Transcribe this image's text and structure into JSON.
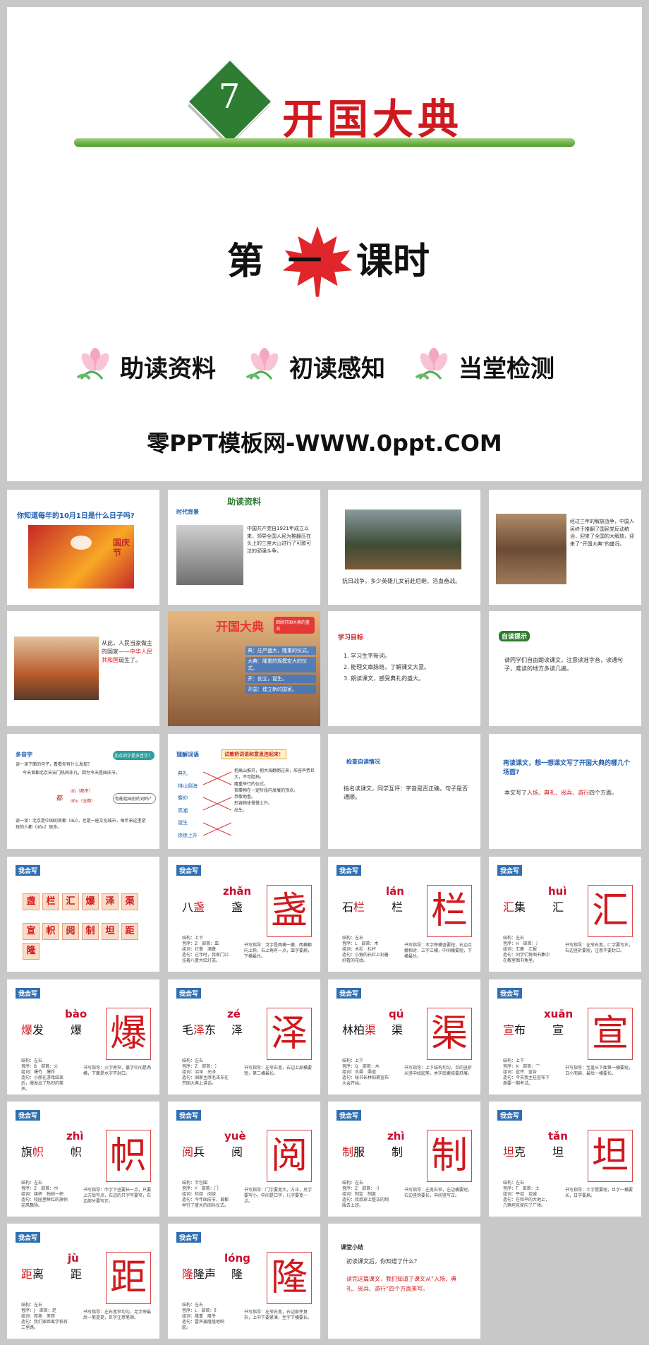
{
  "cover": {
    "lesson_number": "7",
    "title": "开国大典",
    "lesson_prefix": "第",
    "lesson_num_word": "一",
    "lesson_suffix": "课时",
    "sections": [
      "助读资料",
      "初读感知",
      "当堂检测"
    ],
    "footer": "零PPT模板网-WWW.0ppt.COM"
  },
  "slides": {
    "s1": {
      "question": "你知道每年的10月1日是什么日子吗?",
      "festival": "国庆节"
    },
    "s2": {
      "header": "助读资料",
      "tag": "时代背景",
      "text": "中国共产党自1921年成立以来，领导全国人民为推翻压在头上的三座大山进行了可歌可泣的顽强斗争。"
    },
    "s3": {
      "caption": "抗日战争，多少英雄儿女前赴后继、浴血奋战。"
    },
    "s4": {
      "text": "经过三年的解放战争，中国人民终于推翻了国民党反动统治，迎来了全国的大解放，迎来了“开国大典”的盛况。"
    },
    "s5": {
      "text1": "从此，人民当家做主的国家——",
      "highlight": "中华人民共和国",
      "text2": "诞生了。"
    },
    "s6": {
      "title": "开国大典",
      "bubble": "回顾开国大典的盛况",
      "items": [
        "典：庄严盛大，隆重的仪式。",
        "大典：隆重的规模宏大的仪式。",
        "开：创立，诞生。",
        "开国：建立新的国家。"
      ]
    },
    "s7": {
      "tag": "学习目标",
      "goals": [
        "1. 学习生字新词。",
        "2. 能理文章脉络，了解课文大意。",
        "3. 朗读课文，感受典礼的盛大。"
      ]
    },
    "s8": {
      "tag": "自读提示",
      "text": "请同学们自由朗读课文，注意读准字音，读通句子，难读的地方多读几遍。"
    },
    "s9": {
      "tag": "多音字",
      "intro": "读一读下面的句子，看看你有什么发现？",
      "sentence": "今天首都北京天安门热闹非凡，因为今天是国庆节。",
      "bubble1": "加点的字是多音字！",
      "bubble2": "你能组出别的词吗？",
      "reading1": "dū（都市）",
      "reading2": "dōu（全都）",
      "char": "都",
      "practice": "读一读：北京是中国的首都（dū），也是一座文化城市，每年来这里游玩的人都（dōu）很多。"
    },
    "s10": {
      "tag": "理解词语",
      "header": "试着把词语和意思连起来！",
      "words": [
        "典礼",
        "排山倒海",
        "瞻仰",
        "高潮",
        "诞生",
        "徐徐上升"
      ],
      "meanings": [
        "把高山推开，把大海翻倒过来，形容声势巨大，不可阻挡。",
        "隆重举行的仪式。",
        "指事物在一定阶段内发展的顶点。",
        "恭敬地看。",
        "形容物体慢慢上升。",
        "出生。"
      ]
    },
    "s11": {
      "tag": "检查自读情况",
      "text": "指名读课文，同学互评：字音是否正确，句子是否通顺。"
    },
    "s12": {
      "question": "再读课文，想一想课文写了开国大典的哪几个场面?",
      "answer_prefix": "本文写了",
      "scenes": "入场、典礼、阅兵、游行",
      "answer_suffix": "四个方面。"
    },
    "s13": {
      "tag": "我会写",
      "chars": [
        "盏",
        "栏",
        "汇",
        "爆",
        "泽",
        "渠",
        "宣",
        "帜",
        "阅",
        "制",
        "坦",
        "距",
        "隆"
      ]
    },
    "s14": {
      "tag": "我会写",
      "word_red": "盏",
      "word_pre": "八",
      "word_post": "",
      "char": "盏",
      "pinyin": "zhǎn",
      "s1": "结构：上下",
      "s2": "音序：Z　部首：皿",
      "s3": "组词：灯盏　酒盏",
      "s4": "造句：过年时，我家门口挂着八盏大红灯笼。",
      "tip": "书写指导：戈字是两横一撇，两横都向上斜，右上角有一点，皿字要扁，下横最长。"
    },
    "s15": {
      "tag": "我会写",
      "word_red": "栏",
      "word_pre": "石",
      "word_post": "",
      "char": "栏",
      "pinyin": "lán",
      "s1": "结构：左右",
      "s2": "音序：L　部首：木",
      "s3": "组词：木栏　栏杆",
      "s4": "造句：小猴的石栏上刻着好看的花纹。",
      "tip": "书写指导：木字旁横竖要短，右边点撇相对，三字三横，中间横要短，下横最长。"
    },
    "s16": {
      "tag": "我会写",
      "word_red": "汇",
      "word_pre": "",
      "word_post": "集",
      "char": "汇",
      "pinyin": "huì",
      "s1": "结构：左右",
      "s2": "音序：H　部首：氵",
      "s3": "组词：汇集　汇报",
      "s4": "造句：同学们将图书集中在教室图书角里。",
      "tip": "书写指导：左窄右宽，匚字要写正，右边竖折要短，注意不要封口。"
    },
    "s17": {
      "tag": "我会写",
      "word_red": "爆",
      "word_pre": "",
      "word_post": "发",
      "char": "爆",
      "pinyin": "bào",
      "s1": "结构：左右",
      "s2": "音序：B　部首：火",
      "s3": "组词：爆竹　爆炸",
      "s4": "造句：小丽在游戏结束后，爆发出了热烈的笑声。",
      "tip": "书写指导：火字旁窄，暴字中间是两横，下面是水字不封口。"
    },
    "s18": {
      "tag": "我会写",
      "word_red": "泽",
      "word_pre": "毛",
      "word_post": "东",
      "char": "泽",
      "pinyin": "zé",
      "s1": "结构：左右",
      "s2": "音序：Z　部首：氵",
      "s3": "组词：沼泽　光泽",
      "s4": "造句：国家主席毛泽东在开国大典上讲话。",
      "tip": "书写指导：左窄右宽，右边上部横要短，第二横最长。"
    },
    "s19": {
      "tag": "我会写",
      "word_red": "渠",
      "word_pre": "林柏",
      "word_post": "",
      "char": "渠",
      "pinyin": "qú",
      "s1": "结构：上下",
      "s2": "音序：Q　部首：木",
      "s3": "组词：水渠　渠道",
      "s4": "造句：秘书长林柏渠宣布大会开始。",
      "tip": "书写指导：上下结构均匀，巨的竖折从竖中线起笔，木字底撇捺要舒展。"
    },
    "s20": {
      "tag": "我会写",
      "word_red": "宣",
      "word_pre": "",
      "word_post": "布",
      "char": "宣",
      "pinyin": "xuān",
      "s1": "结构：上下",
      "s2": "音序：X　部首：宀",
      "s3": "组词：宣传　宣告",
      "s4": "造句：今天我主任宣布下周要一期考试。",
      "tip": "书写指导：宝盖头下面第一横要短，日小而扁，最后一横要长。"
    },
    "s21": {
      "tag": "我会写",
      "word_red": "帜",
      "word_pre": "旗",
      "word_post": "",
      "char": "帜",
      "pinyin": "zhì",
      "s1": "结构：左右",
      "s2": "音序：Z　部首：巾",
      "s3": "组词：旗帜　独树一帜",
      "s4": "造句：校园里鲜红的旗帜迎风飘扬。",
      "tip": "书写指导：巾字下竖要长一点，只要上方后写点，右边的只字写要窄，右边部分要写正。"
    },
    "s22": {
      "tag": "我会写",
      "word_red": "阅",
      "word_pre": "",
      "word_post": "兵",
      "char": "阅",
      "pinyin": "yuè",
      "s1": "结构：半包围",
      "s2": "音序：Y　部首：门",
      "s3": "组词：检阅　阅读",
      "s4": "造句：今年国庆节，首都举行了盛大的阅兵仪式。",
      "tip": "书写指导：门字要宽大，方正，兑字要写小，中间是口字，儿字要宽一点。"
    },
    "s23": {
      "tag": "我会写",
      "word_red": "制",
      "word_pre": "",
      "word_post": "服",
      "char": "制",
      "pinyin": "zhì",
      "s1": "结构：左右",
      "s2": "音序：Z　部首：刂",
      "s3": "组词：制定　制度",
      "s4": "造句：叔叔穿上整洁的制服去上班。",
      "tip": "书写指导：左宽右窄，左边横要短，右边竖钩要长，中间竖写正。"
    },
    "s24": {
      "tag": "我会写",
      "word_red": "坦",
      "word_pre": "",
      "word_post": "克",
      "char": "坦",
      "pinyin": "tǎn",
      "s1": "结构：左右",
      "s2": "音序：T　部首：土",
      "s3": "组词：平坦　坦诚",
      "s4": "造句：在和平的大地上，几辆坦克驶向了广场。",
      "tip": "书写指导：土字提要短，旦字一横要长，日字要扁。"
    },
    "s25": {
      "tag": "我会写",
      "word_red": "距",
      "word_pre": "",
      "word_post": "离",
      "char": "距",
      "pinyin": "jù",
      "s1": "结构：左右",
      "s2": "音序：J　部首：足",
      "s3": "组词：距离　差距",
      "s4": "造句：我们家距离学校有三里路。",
      "tip": "书写指导：左右宽窄均匀，足字旁最后一笔是提，巨字注意笔顺。"
    },
    "s26": {
      "tag": "我会写",
      "word_red": "隆",
      "word_pre": "",
      "word_post": "隆声",
      "char": "隆",
      "pinyin": "lóng",
      "s1": "结构：左右",
      "s2": "音序：L　部首：阝",
      "s3": "组词：隆重　隆冬",
      "s4": "造句：雷声轰隆隆地响起。",
      "tip": "书写指导：左窄右宽，右边部件复杂，上中下要紧凑，生字下横要长。"
    },
    "s27": {
      "tag": "课堂小结",
      "question": "初读课文后，你知道了什么？",
      "answer_a": "读完这篇课文，我们知道了课文从",
      "answer_b": "“入场、典礼、阅兵、游行”",
      "answer_c": "四个方面来写。"
    }
  }
}
